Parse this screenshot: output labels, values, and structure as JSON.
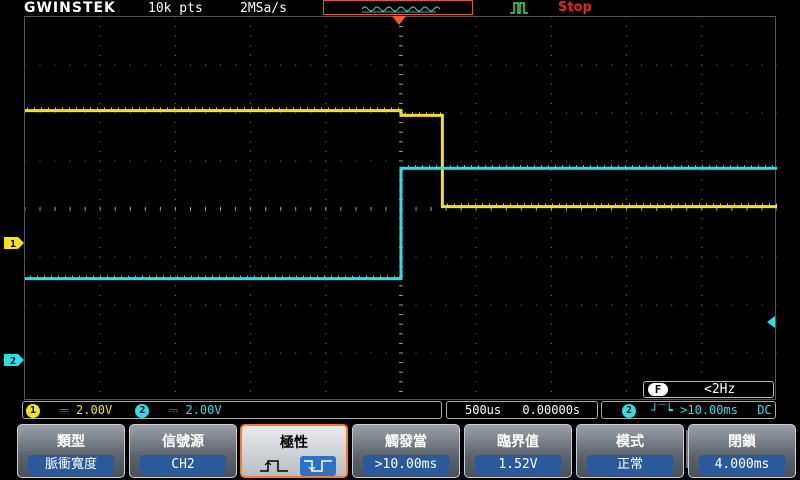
{
  "header": {
    "brand": "GWINSTEK",
    "record_length": "10k pts",
    "sample_rate": "2MSa/s",
    "run_state": "Stop"
  },
  "channels": {
    "ch1": {
      "marker": "1",
      "coupling": "DC",
      "scale": "2.00V",
      "color": "#f5e11a"
    },
    "ch2": {
      "marker": "2",
      "coupling": "DC",
      "scale": "2.00V",
      "color": "#28e0e8"
    }
  },
  "timebase": {
    "scale": "500us",
    "position": "0.00000s"
  },
  "trigger_info": {
    "source_badge": "2",
    "condition": ">10.00ms",
    "coupling": "DC"
  },
  "freq_counter": {
    "label": "F",
    "value": "<2Hz"
  },
  "waveforms": {
    "ch1_levels_div": {
      "before": 2.05,
      "middle": 1.95,
      "after": 0.05
    },
    "ch2_levels_div": {
      "before": -1.45,
      "after": 0.85
    },
    "ch1_step1_time_div": 0.0,
    "ch1_step2_time_div": 0.55,
    "ch2_step_time_div": 0.0
  },
  "menu": {
    "type": {
      "title": "類型",
      "value": "脈衝寬度"
    },
    "source": {
      "title": "信號源",
      "value": "CH2"
    },
    "polarity": {
      "title": "極性",
      "options": [
        "rising",
        "falling"
      ],
      "selected": "falling"
    },
    "when": {
      "title": "觸發當",
      "value": ">10.00ms"
    },
    "threshold": {
      "title": "臨界值",
      "value": "1.52V"
    },
    "mode": {
      "title": "模式",
      "value": "正常"
    },
    "holdoff": {
      "title": "閉鎖",
      "value": "4.000ms"
    }
  }
}
